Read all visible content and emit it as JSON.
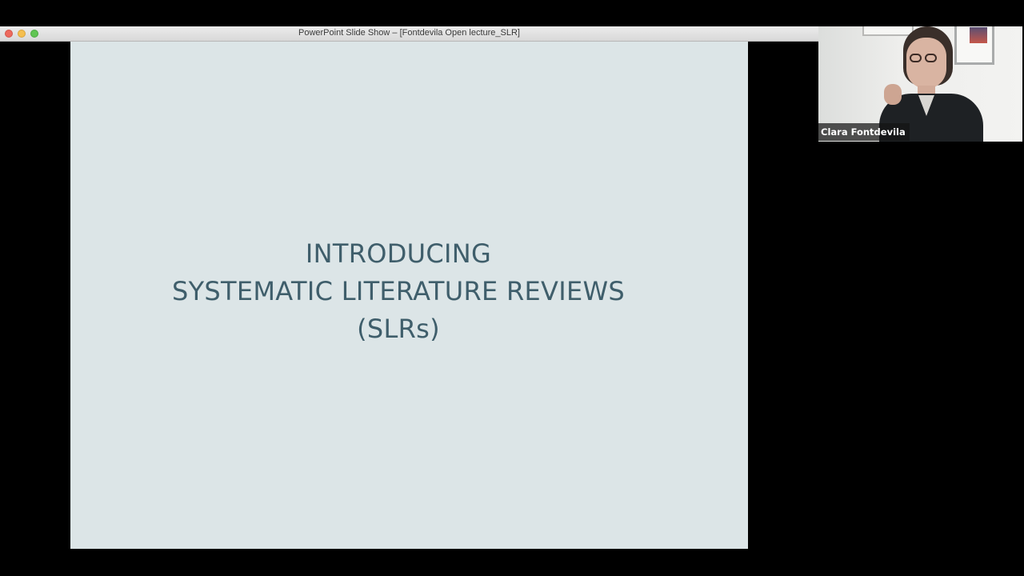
{
  "window": {
    "title": "PowerPoint Slide Show – [Fontdevila Open lecture_SLR]"
  },
  "slide": {
    "title_lines": [
      "INTRODUCING",
      "SYSTEMATIC LITERATURE REVIEWS",
      "(SLRs)"
    ]
  },
  "participant": {
    "name": "Clara Fontdevila"
  },
  "colors": {
    "slide_background": "#dce5e7",
    "slide_text": "#3f5e6b",
    "screen_background": "#000000"
  }
}
